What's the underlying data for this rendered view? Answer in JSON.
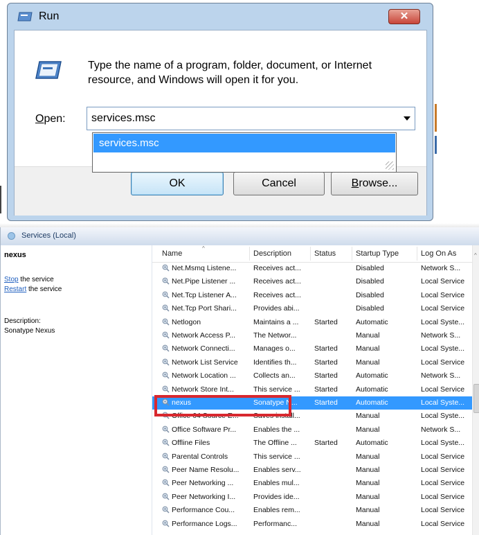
{
  "run_dialog": {
    "title": "Run",
    "close_label": "✕",
    "description": "Type the name of a program, folder, document, or Internet resource, and Windows will open it for you.",
    "open_label_first": "O",
    "open_label_rest": "pen:",
    "open_value": "services.msc",
    "autocomplete_item": "services.msc",
    "ok_label": "OK",
    "cancel_label": "Cancel",
    "browse_label_first": "B",
    "browse_label_rest": "rowse..."
  },
  "services": {
    "header_title": "Services (Local)",
    "selected_name": "nexus",
    "stop_link": "Stop",
    "stop_rest": " the service",
    "restart_link": "Restart",
    "restart_rest": " the service",
    "description_label": "Description:",
    "description_value": "Sonatype Nexus",
    "columns": {
      "name": "Name",
      "description": "Description",
      "status": "Status",
      "startup": "Startup Type",
      "logon": "Log On As"
    },
    "rows": [
      {
        "name": "Net.Msmq Listene...",
        "desc": "Receives act...",
        "status": "",
        "startup": "Disabled",
        "logon": "Network S..."
      },
      {
        "name": "Net.Pipe Listener ...",
        "desc": "Receives act...",
        "status": "",
        "startup": "Disabled",
        "logon": "Local Service"
      },
      {
        "name": "Net.Tcp Listener A...",
        "desc": "Receives act...",
        "status": "",
        "startup": "Disabled",
        "logon": "Local Service"
      },
      {
        "name": "Net.Tcp Port Shari...",
        "desc": "Provides abi...",
        "status": "",
        "startup": "Disabled",
        "logon": "Local Service"
      },
      {
        "name": "Netlogon",
        "desc": "Maintains a ...",
        "status": "Started",
        "startup": "Automatic",
        "logon": "Local Syste..."
      },
      {
        "name": "Network Access P...",
        "desc": "The Networ...",
        "status": "",
        "startup": "Manual",
        "logon": "Network S..."
      },
      {
        "name": "Network Connecti...",
        "desc": "Manages o...",
        "status": "Started",
        "startup": "Manual",
        "logon": "Local Syste..."
      },
      {
        "name": "Network List Service",
        "desc": "Identifies th...",
        "status": "Started",
        "startup": "Manual",
        "logon": "Local Service"
      },
      {
        "name": "Network Location ...",
        "desc": "Collects an...",
        "status": "Started",
        "startup": "Automatic",
        "logon": "Network S..."
      },
      {
        "name": "Network Store Int...",
        "desc": "This service ...",
        "status": "Started",
        "startup": "Automatic",
        "logon": "Local Service"
      },
      {
        "name": "nexus",
        "desc": "Sonatype N...",
        "status": "Started",
        "startup": "Automatic",
        "logon": "Local Syste..."
      },
      {
        "name": "Office 64 Source E...",
        "desc": "Saves install...",
        "status": "",
        "startup": "Manual",
        "logon": "Local Syste..."
      },
      {
        "name": "Office Software Pr...",
        "desc": "Enables the ...",
        "status": "",
        "startup": "Manual",
        "logon": "Network S..."
      },
      {
        "name": "Offline Files",
        "desc": "The Offline ...",
        "status": "Started",
        "startup": "Automatic",
        "logon": "Local Syste..."
      },
      {
        "name": "Parental Controls",
        "desc": "This service ...",
        "status": "",
        "startup": "Manual",
        "logon": "Local Service"
      },
      {
        "name": "Peer Name Resolu...",
        "desc": "Enables serv...",
        "status": "",
        "startup": "Manual",
        "logon": "Local Service"
      },
      {
        "name": "Peer Networking ...",
        "desc": "Enables mul...",
        "status": "",
        "startup": "Manual",
        "logon": "Local Service"
      },
      {
        "name": "Peer Networking I...",
        "desc": "Provides ide...",
        "status": "",
        "startup": "Manual",
        "logon": "Local Service"
      },
      {
        "name": "Performance Cou...",
        "desc": "Enables rem...",
        "status": "",
        "startup": "Manual",
        "logon": "Local Service"
      },
      {
        "name": "Performance Logs...",
        "desc": "Performanc...",
        "status": "",
        "startup": "Manual",
        "logon": "Local Service"
      }
    ],
    "selected_index": 10
  },
  "colors": {
    "selection": "#3399ff",
    "highlight_box": "#d8282f",
    "link": "#1f5fbf"
  }
}
